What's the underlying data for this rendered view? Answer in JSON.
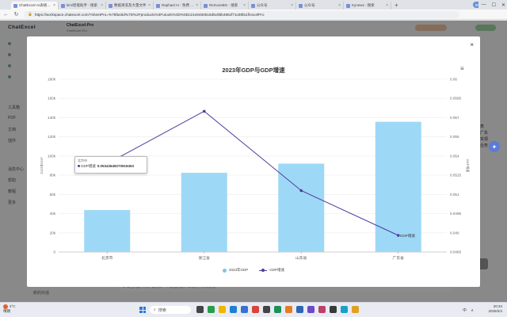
{
  "browser": {
    "tabs": [
      {
        "title": "ChatExcel-AI表格处理"
      },
      {
        "title": "kimi智能助手 - 搜索"
      },
      {
        "title": "数据清洗及大量文件"
      },
      {
        "title": "Raphael AI - 免费 ..."
      },
      {
        "title": "RemoveBG - 搜索"
      },
      {
        "title": "公众号"
      },
      {
        "title": "公众号"
      },
      {
        "title": "Kynews - 搜索"
      }
    ],
    "new_tab": "+",
    "window_controls": [
      "—",
      "☐",
      "✕"
    ],
    "profile": "00:07",
    "url": "https://workspace.chatexcel.com/?sheetPro=%78fastId%7D%2Fproducts%3Futools%3D%5Dc21e8450615d5c9bb486cf71c89fa1f/excelPro"
  },
  "app": {
    "logo": "ChatExcel",
    "title": "ChatExcel-Pro",
    "subtitle": "ChatExcel-Pro",
    "sidebar_labels": [
      "工具箱",
      "PDF",
      "文档",
      "插件",
      "消息中心",
      "帮助",
      "教程",
      "更多"
    ],
    "right_panel": [
      "表",
      "广东",
      "实现",
      "业务"
    ],
    "input_placeholder": "4. 以上内容中用户输入的一个段落内容，可以用于所有结果",
    "footer": "新的对话"
  },
  "modal": {
    "close": "×",
    "menu": "≡",
    "tooltip": {
      "category": "北京市",
      "series": "GDP增速",
      "value": "0.05343649270919453"
    }
  },
  "chart_data": {
    "type": "bar",
    "title": "2023年GDP与GDP增速",
    "categories": [
      "北京市",
      "浙江省",
      "山东省",
      "广东省"
    ],
    "series": [
      {
        "name": "2023年GDP",
        "type": "bar",
        "axis": "left",
        "values": [
          43760,
          82553,
          92069,
          135673
        ],
        "color": "#9ed8f7"
      },
      {
        "name": "GDP增速",
        "type": "line",
        "axis": "right",
        "values": [
          0.0534,
          0.0575,
          0.0513,
          0.0478
        ],
        "color": "#4b3d9c"
      }
    ],
    "ylabel_left": "2023年GDP",
    "ylabel_right": "GDP增速",
    "ylim_left": [
      0,
      180000
    ],
    "yticks_left": [
      "0",
      "20k",
      "40k",
      "60k",
      "80k",
      "100k",
      "120k",
      "140k",
      "160k",
      "180k"
    ],
    "ylim_right": [
      0.0465,
      0.06
    ],
    "yticks_right": [
      "0.0465",
      "0.048",
      "0.0495",
      "0.051",
      "0.0525",
      "0.054",
      "0.055",
      "0.057",
      "0.0585",
      "0.06"
    ],
    "point_label": "GDP增速",
    "legend": "bottom",
    "grid": true
  },
  "taskbar": {
    "weather_temp": "4°C",
    "weather_desc": "晴朗",
    "search": "搜索",
    "time": "20:34",
    "date": "2025/2/4",
    "tray": "中 ∧"
  },
  "colors": {
    "bar": "#9ed8f7",
    "line": "#4b3d9c",
    "overlay": "rgba(0,0,0,0.45)"
  }
}
